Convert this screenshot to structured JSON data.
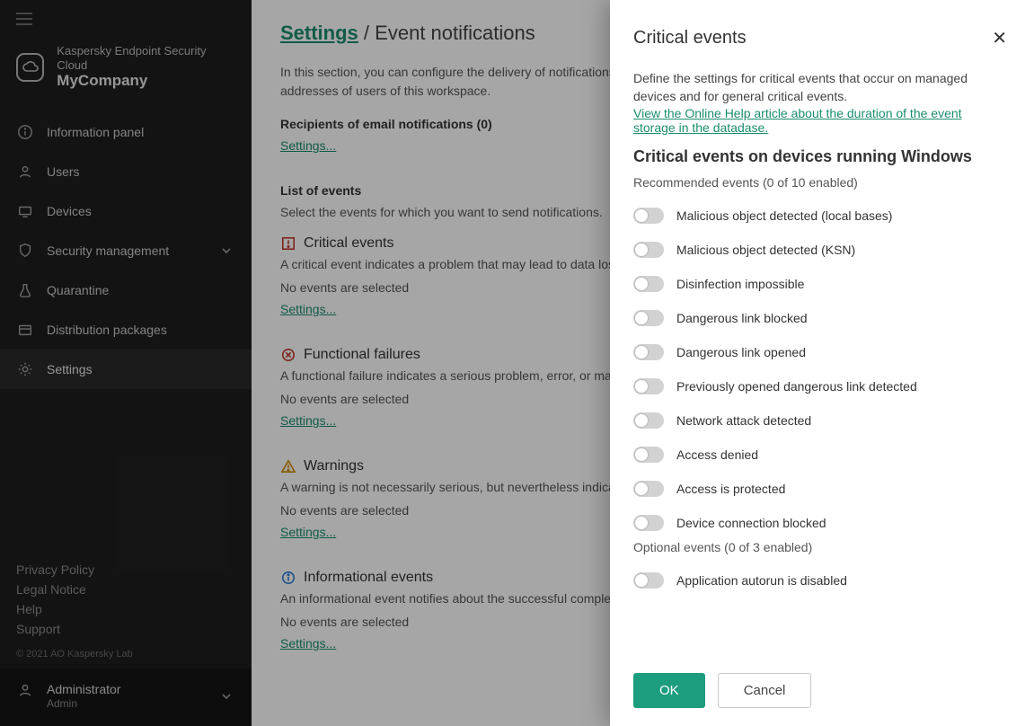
{
  "brand": {
    "line1": "Kaspersky Endpoint Security Cloud",
    "line2": "MyCompany"
  },
  "nav": {
    "info": "Information panel",
    "users": "Users",
    "devices": "Devices",
    "security": "Security management",
    "quarantine": "Quarantine",
    "dist": "Distribution packages",
    "settings": "Settings"
  },
  "footer": {
    "privacy": "Privacy Policy",
    "legal": "Legal Notice",
    "help": "Help",
    "support": "Support",
    "copyright": "© 2021 AO Kaspersky Lab"
  },
  "user": {
    "name": "Administrator",
    "role": "Admin"
  },
  "crumb": {
    "root": "Settings",
    "sep": "/",
    "page": "Event notifications"
  },
  "main": {
    "intro": "In this section, you can configure the delivery of notifications about events on devices and about general events to the email addresses of users of this workspace.",
    "recipients": "Recipients of email notifications (0)",
    "settings_link": "Settings...",
    "list_heading": "List of events",
    "list_sub": "Select the events for which you want to send notifications.",
    "noevents": "No events are selected",
    "groups": {
      "critical": {
        "title": "Critical events",
        "desc": "A critical event indicates a problem that may lead to data loss or malfunctioning."
      },
      "func": {
        "title": "Functional failures",
        "desc": "A functional failure indicates a serious problem, error, or malfunction that occurred during operation."
      },
      "warn": {
        "title": "Warnings",
        "desc": "A warning is not necessarily serious, but nevertheless indicates a potential future problem."
      },
      "info": {
        "title": "Informational events",
        "desc": "An informational event notifies about the successful completion of an operation or a procedure in the application."
      }
    }
  },
  "panel": {
    "title": "Critical events",
    "desc": "Define the settings for critical events that occur on managed devices and for general critical events.",
    "link": "View the Online Help article about the duration of the event storage in the datadase.",
    "subheading": "Critical events on devices running Windows",
    "rec_counter": "Recommended events (0 of 10 enabled)",
    "opt_counter": "Optional events (0 of 3 enabled)",
    "events": {
      "e0": "Malicious object detected (local bases)",
      "e1": "Malicious object detected (KSN)",
      "e2": "Disinfection impossible",
      "e3": "Dangerous link blocked",
      "e4": "Dangerous link opened",
      "e5": "Previously opened dangerous link detected",
      "e6": "Network attack detected",
      "e7": "Access denied",
      "e8": "Access is protected",
      "e9": "Device connection blocked",
      "o0": "Application autorun is disabled"
    },
    "ok": "OK",
    "cancel": "Cancel"
  }
}
